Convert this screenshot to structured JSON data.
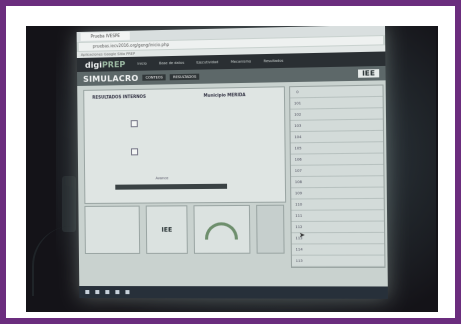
{
  "scene": {
    "border_color": "#6b2d7e",
    "background": "#141318"
  },
  "browser": {
    "tab_title": "Prueba IVESPE",
    "url": "pruebas.iecv2016.org/geng/inicio.php",
    "bookmarks": "Aplicaciones  Google  Sitio PREP"
  },
  "site": {
    "logo_main": "digi",
    "logo_accent": "PREP",
    "nav": [
      "Inicio",
      "Base de datos",
      "Ejecutividad",
      "Mecanismo",
      "Resultados"
    ]
  },
  "banner": {
    "title": "SIMULACRO",
    "pill_1": "CONTEOS",
    "pill_2": "RESULTADOS",
    "right_label": "IEE"
  },
  "main": {
    "section_left": "RESULTADOS INTERNOS",
    "section_right": "Municipio MERIDA",
    "progress_label": "Avance"
  },
  "table": {
    "rows": [
      "0",
      "101",
      "102",
      "103",
      "104",
      "105",
      "106",
      "107",
      "108",
      "109",
      "110",
      "111",
      "112",
      "113",
      "114",
      "115"
    ]
  },
  "lower": {
    "panel_label": "IEE"
  }
}
